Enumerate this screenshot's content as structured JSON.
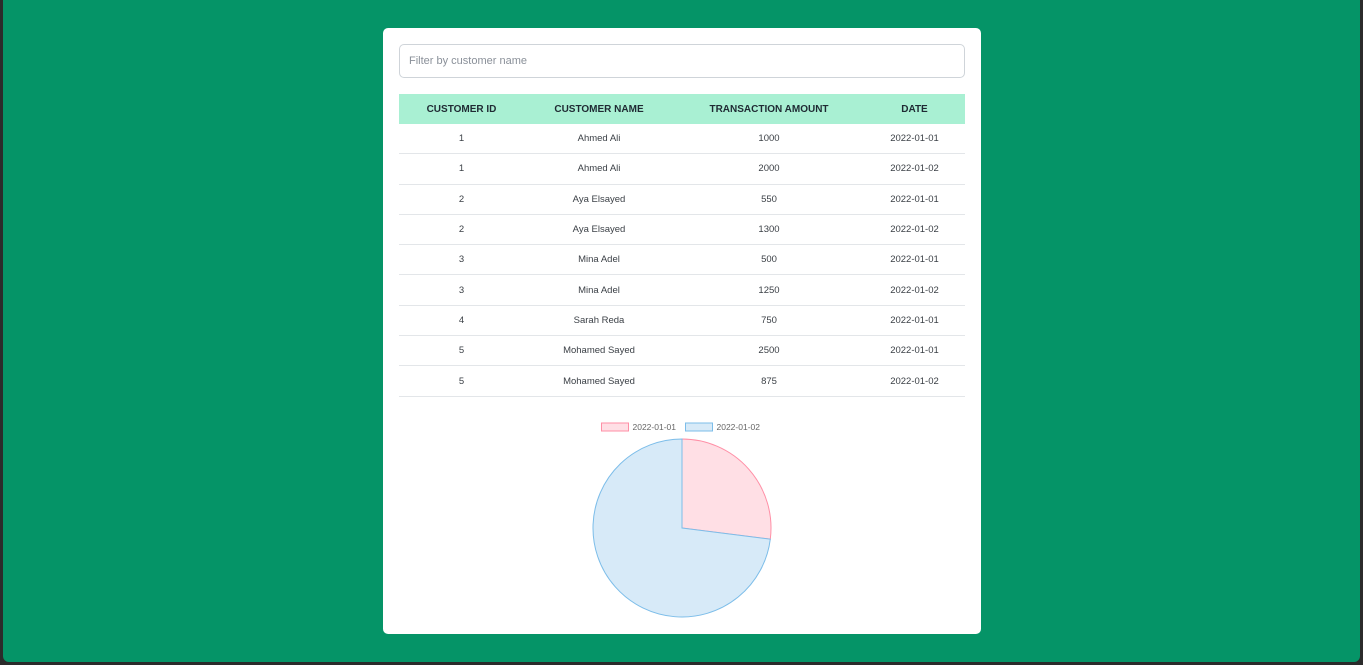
{
  "filter": {
    "placeholder": "Filter by customer name",
    "value": ""
  },
  "table": {
    "headers": [
      "CUSTOMER ID",
      "CUSTOMER NAME",
      "TRANSACTION AMOUNT",
      "DATE"
    ],
    "rows": [
      [
        "1",
        "Ahmed Ali",
        "1000",
        "2022-01-01"
      ],
      [
        "1",
        "Ahmed Ali",
        "2000",
        "2022-01-02"
      ],
      [
        "2",
        "Aya Elsayed",
        "550",
        "2022-01-01"
      ],
      [
        "2",
        "Aya Elsayed",
        "1300",
        "2022-01-02"
      ],
      [
        "3",
        "Mina Adel",
        "500",
        "2022-01-01"
      ],
      [
        "3",
        "Mina Adel",
        "1250",
        "2022-01-02"
      ],
      [
        "4",
        "Sarah Reda",
        "750",
        "2022-01-01"
      ],
      [
        "5",
        "Mohamed Sayed",
        "2500",
        "2022-01-01"
      ],
      [
        "5",
        "Mohamed Sayed",
        "875",
        "2022-01-02"
      ]
    ]
  },
  "colors": {
    "page_background": "#059467",
    "table_header_background": "#a9f0d3"
  },
  "chart_data": {
    "type": "pie",
    "title": "",
    "legend_position": "top",
    "labels": [
      "2022-01-01",
      "2022-01-02"
    ],
    "values": [
      27,
      73
    ],
    "fill_colors": [
      "#ffdfe5",
      "#d7eaf8"
    ],
    "border_colors": [
      "#ff8fa6",
      "#7cbde9"
    ]
  }
}
